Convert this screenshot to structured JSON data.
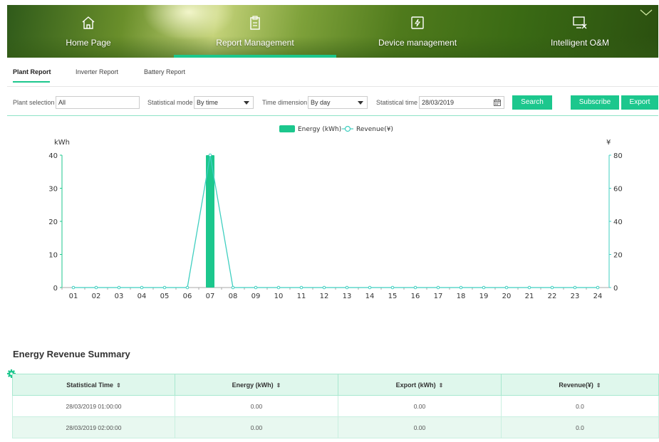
{
  "nav": {
    "items": [
      {
        "label": "Home Page",
        "icon": "home-icon",
        "active": false
      },
      {
        "label": "Report Management",
        "icon": "clipboard-icon",
        "active": true
      },
      {
        "label": "Device management",
        "icon": "device-icon",
        "active": false
      },
      {
        "label": "Intelligent O&M",
        "icon": "monitor-tools-icon",
        "active": false
      }
    ],
    "accent": "#1cc78d"
  },
  "subtabs": [
    "Plant Report",
    "Inverter Report",
    "Battery Report"
  ],
  "filters": {
    "plant_selection_label": "Plant selection",
    "plant_selection_value": "All",
    "statistical_mode_label": "Statistical mode",
    "statistical_mode_value": "By time",
    "time_dimension_label": "Time dimension",
    "time_dimension_value": "By day",
    "statistical_time_label": "Statistical time",
    "statistical_time_value": "28/03/2019",
    "search_label": "Search",
    "subscribe_label": "Subscribe",
    "export_label": "Export"
  },
  "chart_data": {
    "type": "bar",
    "legend": [
      "Energy (kWh)",
      "Revenue(¥)"
    ],
    "legend_position": "top-center",
    "ylabel_left": "kWh",
    "ylabel_right": "¥",
    "ylim_left": [
      0,
      40
    ],
    "ylim_right": [
      0,
      80
    ],
    "yticks_left": [
      0,
      10,
      20,
      30,
      40
    ],
    "yticks_right": [
      0,
      20,
      40,
      60,
      80
    ],
    "categories": [
      "01",
      "02",
      "03",
      "04",
      "05",
      "06",
      "07",
      "08",
      "09",
      "10",
      "11",
      "12",
      "13",
      "14",
      "15",
      "16",
      "17",
      "18",
      "19",
      "20",
      "21",
      "22",
      "23",
      "24"
    ],
    "series": [
      {
        "name": "Energy (kWh)",
        "type": "bar",
        "axis": "left",
        "color": "#1cc78d",
        "values": [
          0,
          0,
          0,
          0,
          0,
          0,
          40,
          0,
          0,
          0,
          0,
          0,
          0,
          0,
          0,
          0,
          0,
          0,
          0,
          0,
          0,
          0,
          0,
          0
        ]
      },
      {
        "name": "Revenue(¥)",
        "type": "line",
        "axis": "right",
        "color": "#3fcfc0",
        "values": [
          0,
          0,
          0,
          0,
          0,
          0,
          80,
          0,
          0,
          0,
          0,
          0,
          0,
          0,
          0,
          0,
          0,
          0,
          0,
          0,
          0,
          0,
          0,
          0
        ]
      }
    ]
  },
  "summary": {
    "title": "Energy Revenue Summary",
    "columns": [
      "Statistical Time",
      "Energy (kWh)",
      "Export (kWh)",
      "Revenue(¥)"
    ],
    "sort_glyph": "⇕",
    "rows": [
      [
        "28/03/2019 01:00:00",
        "0.00",
        "0.00",
        "0.0"
      ],
      [
        "28/03/2019 02:00:00",
        "0.00",
        "0.00",
        "0.0"
      ]
    ]
  }
}
